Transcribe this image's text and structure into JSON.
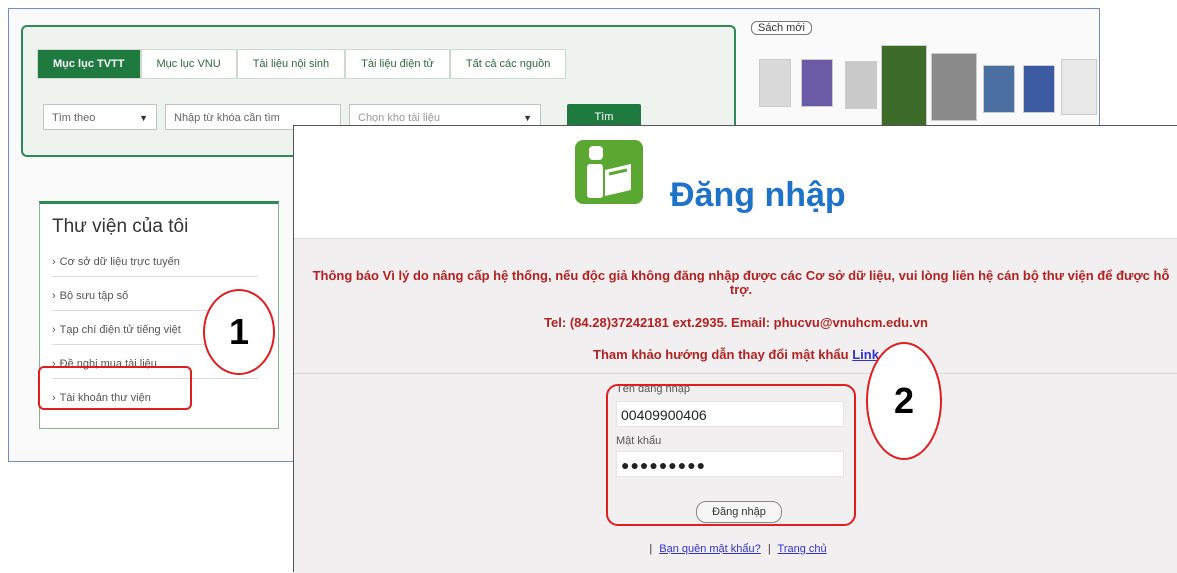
{
  "search": {
    "tabs": [
      "Mục lục TVTT",
      "Mục lục VNU",
      "Tài liệu nội sinh",
      "Tài liệu điện tử",
      "Tất cả các nguồn"
    ],
    "field_select": "Tìm theo",
    "keyword_placeholder": "Nhập từ khóa cần tìm",
    "collection_select": "Chọn kho tài liệu",
    "find_label": "Tìm"
  },
  "new_books": {
    "title": "Sách mới"
  },
  "my_library": {
    "title": "Thư viện của tôi",
    "items": [
      "Cơ sở dữ liệu trực tuyến",
      "Bộ sưu tập số",
      "Tạp chí điện tử tiếng việt",
      "Đề nghị mua tài liệu",
      "Tài khoản thư viện"
    ]
  },
  "annotations": {
    "step1": "1",
    "step2": "2"
  },
  "login": {
    "title": "Đăng nhập",
    "notice": "Thông báo Vì lý do nâng cấp hệ thống, nếu độc giả không đăng nhập được các Cơ sở dữ liệu, vui lòng liên hệ cán bộ thư viện để được hỗ trợ.",
    "contact": "Tel: (84.28)37242181 ext.2935. Email: phucvu@vnuhcm.edu.vn",
    "guide_text": "Tham khảo hướng dẫn thay đổi mật khẩu",
    "guide_link": "Link",
    "username_label": "Tên đăng nhập",
    "username_value": "00409900406",
    "password_label": "Mật khẩu",
    "password_value": "●●●●●●●●●",
    "submit_label": "Đăng nhập",
    "forgot_link": "Bạn quên mật khẩu?",
    "home_link": "Trang chủ"
  },
  "colors": {
    "accent_green": "#1e7a3f",
    "title_blue": "#1e73c8",
    "notice_red": "#b22222",
    "annotation_red": "#e01e1e"
  }
}
